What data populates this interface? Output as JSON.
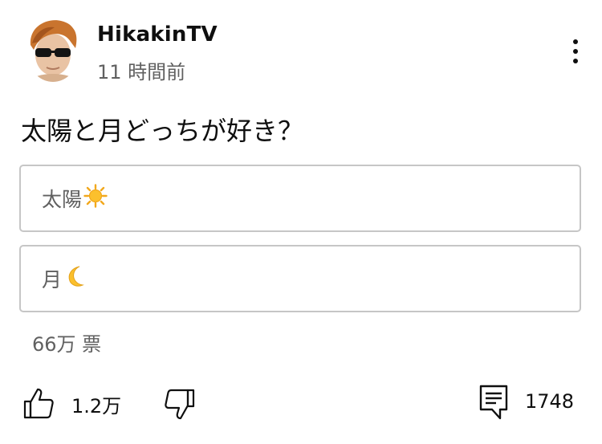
{
  "post": {
    "channel_name": "HikakinTV",
    "time_ago": "11 時間前",
    "question": "太陽と月どっちが好き？"
  },
  "poll": {
    "options": [
      {
        "label": "太陽",
        "icon": "sun-icon"
      },
      {
        "label": "月",
        "icon": "crescent-moon-icon"
      }
    ],
    "votes": "66万 票"
  },
  "actions": {
    "like_count": "1.2万",
    "comment_count": "1748"
  },
  "colors": {
    "text_primary": "#0f0f0f",
    "text_secondary": "#606060",
    "option_border": "#c6c6c6"
  }
}
